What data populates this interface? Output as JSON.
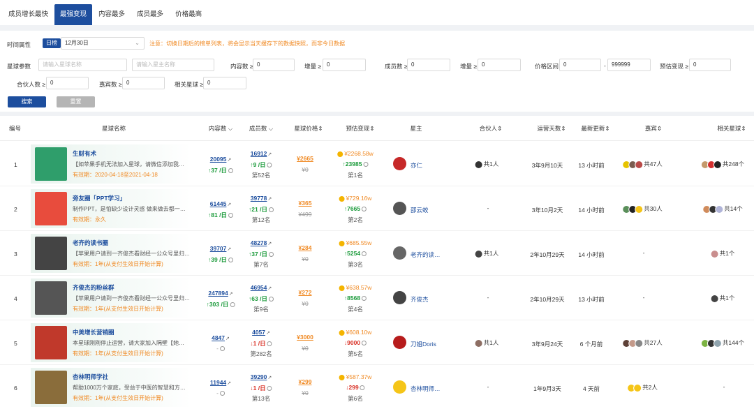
{
  "tabs": [
    "成员增长最快",
    "最强变现",
    "内容最多",
    "成员最多",
    "价格最高"
  ],
  "active_tab": 1,
  "filters": {
    "time_label": "时间属性",
    "daily_pill": "日榜",
    "date_value": "12月30日",
    "notice": "注意：切换日期后的榜单列表，将会显示当天缓存下的数据快照，而非今日数据",
    "params_label": "星球参数",
    "planet_name_placeholder": "请输入星球名称",
    "owner_name_placeholder": "请输入星主名称",
    "content_label": "内容数 ≥",
    "content_value": "0",
    "growth_label1": "增量 ≥",
    "growth_value1": "0",
    "members_label": "成员数 ≥",
    "members_value": "0",
    "growth_label2": "增量 ≥",
    "growth_value2": "0",
    "price_label": "价格区间",
    "price_min": "0",
    "price_sep": "-",
    "price_max": "999999",
    "est_label": "预估变现 ≥",
    "est_value": "0",
    "partners_label": "合伙人数 ≥",
    "partners_value": "0",
    "guests_label": "嘉宾数 ≥",
    "guests_value": "0",
    "related_label": "相关星球 ≥",
    "related_value": "0",
    "search_btn": "搜索",
    "reset_btn": "重置"
  },
  "headers": {
    "index": "编号",
    "name": "星球名称",
    "content": "内容数",
    "members": "成员数",
    "price": "星球价格",
    "est": "预估变现",
    "owner": "星主",
    "partners": "合伙人",
    "days": "运营天数",
    "updated": "最新更新",
    "guests": "嘉宾",
    "related": "相关星球"
  },
  "rows": [
    {
      "index": "1",
      "name": "生财有术",
      "desc": "【如苹果手机无法加入星球，请微信添加我…",
      "expiry": "有效期：2020-04-18至2021-04-18",
      "content": "20095",
      "content_delta": "↑37 /日",
      "members": "16912",
      "members_delta": "↑9 /日",
      "members_rank": "第52名",
      "price": "¥2665",
      "old_price": "¥0",
      "est": "¥2268.58w",
      "est_delta": "↑23985",
      "est_rank": "第1名",
      "owner": "亦仁",
      "partners": "共1人",
      "days": "3年9月10天",
      "updated": "13 小时前",
      "guests": "共47人",
      "related": "共248个",
      "thumb": "#2f9e6b",
      "owner_color": "#c62828",
      "partner_colors": [
        "#333"
      ],
      "guest_colors": [
        "#e6c300",
        "#7a5c4f",
        "#b94a48"
      ],
      "related_colors": [
        "#c49a6c",
        "#d32f2f",
        "#222"
      ],
      "content_trend": "up",
      "members_trend": "up",
      "est_trend": "up"
    },
    {
      "index": "2",
      "name": "旁友圈「PPT学习」",
      "desc": "制作PPT，是怕缺少设计灵感 做来做去都一…",
      "expiry": "有效期：永久",
      "content": "61445",
      "content_delta": "↑81 /日",
      "members": "39778",
      "members_delta": "↑21 /日",
      "members_rank": "第12名",
      "price": "¥365",
      "old_price": "¥499",
      "est": "¥729.16w",
      "est_delta": "↑7665",
      "est_rank": "第2名",
      "owner": "邵云蛟",
      "partners": "-",
      "days": "3年10月2天",
      "updated": "14 小时前",
      "guests": "共30人",
      "related": "共14个",
      "thumb": "#e84c3d",
      "owner_color": "#555",
      "partner_colors": [],
      "guest_colors": [
        "#5a8f5a",
        "#222",
        "#f5c518"
      ],
      "related_colors": [
        "#d08b5b",
        "#333",
        "#b0b4d8"
      ],
      "content_trend": "up",
      "members_trend": "up",
      "est_trend": "up"
    },
    {
      "index": "3",
      "name": "老齐的读书圈",
      "desc": "【苹果用户请到一齐俊杰看财经一公众号里归…",
      "expiry": "有效期：1年(从支付生效日开始计算)",
      "content": "39707",
      "content_delta": "↑39 /日",
      "members": "48278",
      "members_delta": "↑37 /日",
      "members_rank": "第7名",
      "price": "¥284",
      "old_price": "¥0",
      "est": "¥685.55w",
      "est_delta": "↑5254",
      "est_rank": "第3名",
      "owner": "老齐的读…",
      "partners": "共1人",
      "days": "2年10月29天",
      "updated": "14 小时前",
      "guests": "-",
      "related": "共1个",
      "thumb": "#444",
      "owner_color": "#666",
      "partner_colors": [
        "#444"
      ],
      "guest_colors": [],
      "related_colors": [
        "#c98e8e"
      ],
      "content_trend": "up",
      "members_trend": "up",
      "est_trend": "up"
    },
    {
      "index": "4",
      "name": "齐俊杰的粉丝群",
      "desc": "【苹果用户请到一齐俊杰看财经一公众号里归…",
      "expiry": "有效期：1年(从支付生效日开始计算)",
      "content": "247894",
      "content_delta": "↑303 /日",
      "members": "46954",
      "members_delta": "↑63 /日",
      "members_rank": "第9名",
      "price": "¥272",
      "old_price": "¥0",
      "est": "¥638.57w",
      "est_delta": "↑8568",
      "est_rank": "第4名",
      "owner": "齐俊杰",
      "partners": "-",
      "days": "2年10月29天",
      "updated": "13 小时前",
      "guests": "-",
      "related": "共1个",
      "thumb": "#555",
      "owner_color": "#444",
      "partner_colors": [],
      "guest_colors": [],
      "related_colors": [
        "#444"
      ],
      "content_trend": "up",
      "members_trend": "up",
      "est_trend": "up"
    },
    {
      "index": "5",
      "name": "中美增长营销圈",
      "desc": "本星球刚刚停止运营，请大家加入隔壁【她…",
      "expiry": "有效期：1年(从支付生效日开始计算)",
      "content": "4847",
      "content_delta": "-",
      "members": "4057",
      "members_delta": "↓1 /日",
      "members_rank": "第282名",
      "price": "¥3000",
      "old_price": "¥0",
      "est": "¥608.10w",
      "est_delta": "↓9000",
      "est_rank": "第5名",
      "owner": "刀姐Doris",
      "partners": "共1人",
      "days": "3年9月24天",
      "updated": "6 个月前",
      "guests": "共27人",
      "related": "共144个",
      "thumb": "#c0392b",
      "owner_color": "#b71c1c",
      "partner_colors": [
        "#8d6e63"
      ],
      "guest_colors": [
        "#5d4037",
        "#c49a8a",
        "#888"
      ],
      "related_colors": [
        "#7cb342",
        "#333",
        "#90a4ae"
      ],
      "content_trend": "none",
      "members_trend": "down",
      "est_trend": "down"
    },
    {
      "index": "6",
      "name": "杏林明师学社",
      "desc": "帮助1000万个家庭，受益于中医的智慧和方…",
      "expiry": "有效期：1年(从支付生效日开始计算)",
      "content": "11944",
      "content_delta": "-",
      "members": "39290",
      "members_delta": "↓1 /日",
      "members_rank": "第13名",
      "price": "¥299",
      "old_price": "¥0",
      "est": "¥587.37w",
      "est_delta": "↓299",
      "est_rank": "第6名",
      "owner": "杏林明师…",
      "partners": "-",
      "days": "1年9月3天",
      "updated": "4 天前",
      "guests": "共2人",
      "related": "-",
      "thumb": "#8a6d3b",
      "owner_color": "#f5c518",
      "partner_colors": [],
      "guest_colors": [
        "#f5c518",
        "#f5c518"
      ],
      "related_colors": [],
      "content_trend": "none",
      "members_trend": "down",
      "est_trend": "down"
    }
  ]
}
